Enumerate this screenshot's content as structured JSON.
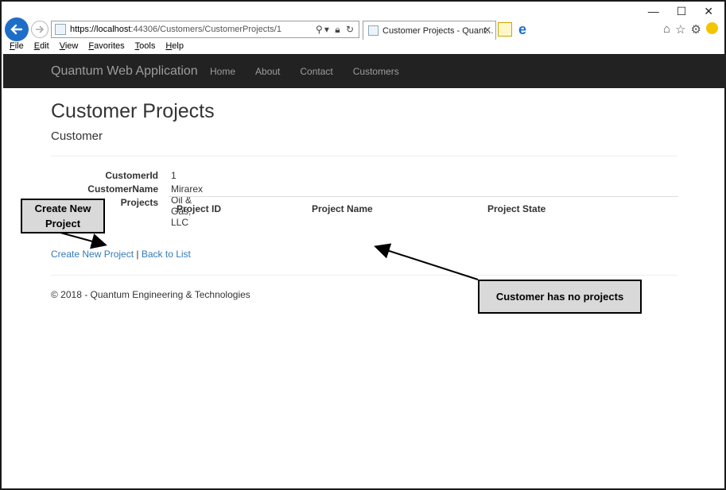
{
  "browser": {
    "url_host": "https://localhost",
    "url_rest": ":44306/Customers/CustomerProjects/1",
    "tab_title": "Customer Projects - Quant...",
    "tab_close": "✕",
    "menu": [
      "File",
      "Edit",
      "View",
      "Favorites",
      "Tools",
      "Help"
    ],
    "window_controls": [
      "—",
      "☐",
      "✕"
    ],
    "icons": [
      "back-arrow-icon",
      "forward-arrow-icon",
      "search-icon",
      "lock-icon",
      "refresh-icon",
      "home-icon",
      "star-icon",
      "gear-icon",
      "smiley-icon"
    ]
  },
  "navbar": {
    "brand": "Quantum Web Application",
    "links": [
      "Home",
      "About",
      "Contact",
      "Customers"
    ]
  },
  "page": {
    "title": "Customer Projects",
    "subtitle": "Customer",
    "fields": {
      "customer_id_label": "CustomerId",
      "customer_id_value": "1",
      "customer_name_label": "CustomerName",
      "customer_name_value": "Mirarex Oil & Gas, LLC",
      "projects_label": "Projects"
    },
    "table_headers": [
      "Project ID",
      "Project Name",
      "Project State"
    ],
    "links": {
      "create": "Create New Project",
      "separator": "|",
      "back": "Back to List"
    },
    "footer": "© 2018 - Quantum Engineering & Technologies"
  },
  "annotations": {
    "create_callout": "Create New Project",
    "no_projects_callout": "Customer has no projects"
  }
}
